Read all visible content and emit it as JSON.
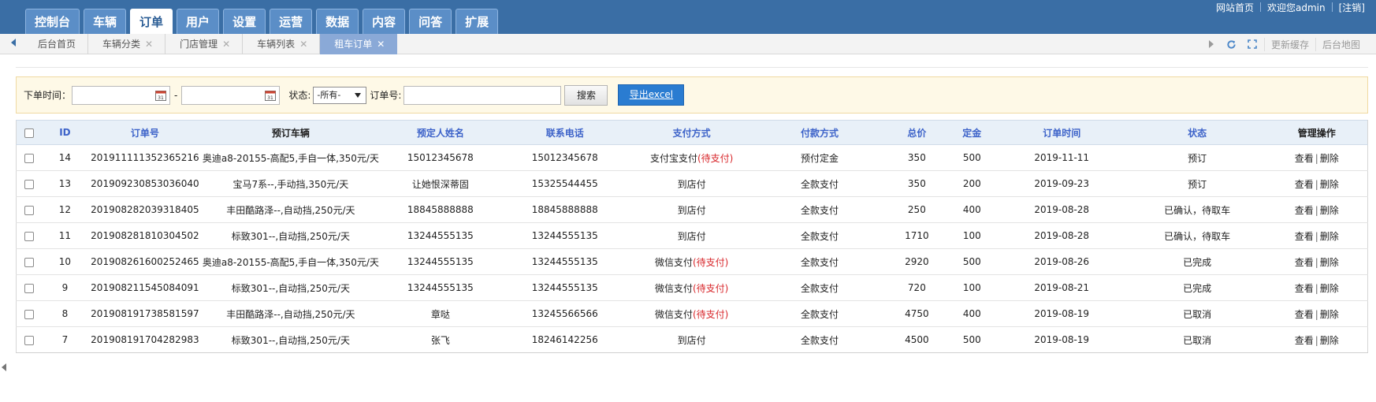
{
  "top_nav": {
    "items": [
      "控制台",
      "车辆",
      "订单",
      "用户",
      "设置",
      "运营",
      "数据",
      "内容",
      "问答",
      "扩展"
    ],
    "active_index": 2
  },
  "top_links": {
    "home": "网站首页",
    "welcome": "欢迎您admin",
    "logout": "[注销]"
  },
  "page_tabs": [
    {
      "label": "后台首页",
      "closable": false,
      "active": false
    },
    {
      "label": "车辆分类",
      "closable": true,
      "active": false
    },
    {
      "label": "门店管理",
      "closable": true,
      "active": false
    },
    {
      "label": "车辆列表",
      "closable": true,
      "active": false
    },
    {
      "label": "租车订单",
      "closable": true,
      "active": true
    }
  ],
  "tab_tools": {
    "refresh_cache": "更新缓存",
    "site_map": "后台地图"
  },
  "filter": {
    "order_time_label": "下单时间：",
    "date_separator": "-",
    "status_label": "状态:",
    "status_selected": "-所有-",
    "order_no_label": "订单号:",
    "search_button": "搜索",
    "export_button": "导出excel"
  },
  "table": {
    "headers": [
      "ID",
      "订单号",
      "预订车辆",
      "预定人姓名",
      "联系电话",
      "支付方式",
      "付款方式",
      "总价",
      "定金",
      "订单时间",
      "状态",
      "管理操作"
    ],
    "action_view": "查看",
    "action_delete": "删除",
    "action_sep": "|",
    "rows": [
      {
        "id": "14",
        "order_no": "201911111352365216",
        "car": "奥迪a8-20155-高配5,手自一体,350元/天",
        "name": "15012345678",
        "phone": "15012345678",
        "pay_method": "支付宝支付",
        "pay_note": "(待支付)",
        "payment": "预付定金",
        "payment_green": true,
        "total": "350",
        "deposit": "500",
        "time": "2019-11-11",
        "status": "预订"
      },
      {
        "id": "13",
        "order_no": "201909230853036040",
        "car": "宝马7系--,手动挡,350元/天",
        "name": "让她恨深蒂固",
        "phone": "15325544455",
        "pay_method": "到店付",
        "pay_note": "",
        "payment": "全款支付",
        "payment_green": false,
        "total": "350",
        "deposit": "200",
        "time": "2019-09-23",
        "status": "预订"
      },
      {
        "id": "12",
        "order_no": "201908282039318405",
        "car": "丰田酷路泽--,自动挡,250元/天",
        "name": "18845888888",
        "phone": "18845888888",
        "pay_method": "到店付",
        "pay_note": "",
        "payment": "全款支付",
        "payment_green": false,
        "total": "250",
        "deposit": "400",
        "time": "2019-08-28",
        "status": "已确认，待取车"
      },
      {
        "id": "11",
        "order_no": "201908281810304502",
        "car": "标致301--,自动挡,250元/天",
        "name": "13244555135",
        "phone": "13244555135",
        "pay_method": "到店付",
        "pay_note": "",
        "payment": "全款支付",
        "payment_green": false,
        "total": "1710",
        "deposit": "100",
        "time": "2019-08-28",
        "status": "已确认，待取车"
      },
      {
        "id": "10",
        "order_no": "201908261600252465",
        "car": "奥迪a8-20155-高配5,手自一体,350元/天",
        "name": "13244555135",
        "phone": "13244555135",
        "pay_method": "微信支付",
        "pay_note": "(待支付)",
        "payment": "全款支付",
        "payment_green": false,
        "total": "2920",
        "deposit": "500",
        "time": "2019-08-26",
        "status": "已完成"
      },
      {
        "id": "9",
        "order_no": "201908211545084091",
        "car": "标致301--,自动挡,250元/天",
        "name": "13244555135",
        "phone": "13244555135",
        "pay_method": "微信支付",
        "pay_note": "(待支付)",
        "payment": "全款支付",
        "payment_green": false,
        "total": "720",
        "deposit": "100",
        "time": "2019-08-21",
        "status": "已完成"
      },
      {
        "id": "8",
        "order_no": "201908191738581597",
        "car": "丰田酷路泽--,自动挡,250元/天",
        "name": "章哒",
        "phone": "13245566566",
        "pay_method": "微信支付",
        "pay_note": "(待支付)",
        "payment": "全款支付",
        "payment_green": false,
        "total": "4750",
        "deposit": "400",
        "time": "2019-08-19",
        "status": "已取消"
      },
      {
        "id": "7",
        "order_no": "201908191704282983",
        "car": "标致301--,自动挡,250元/天",
        "name": "张飞",
        "phone": "18246142256",
        "pay_method": "到店付",
        "pay_note": "",
        "payment": "全款支付",
        "payment_green": false,
        "total": "4500",
        "deposit": "500",
        "time": "2019-08-19",
        "status": "已取消"
      }
    ]
  },
  "colors": {
    "nav_bg": "#3a6ea5",
    "link_blue": "#3d63c9",
    "warn_red": "#d8272b",
    "ok_green": "#2a8a1f",
    "export_blue": "#2a7cd1"
  }
}
